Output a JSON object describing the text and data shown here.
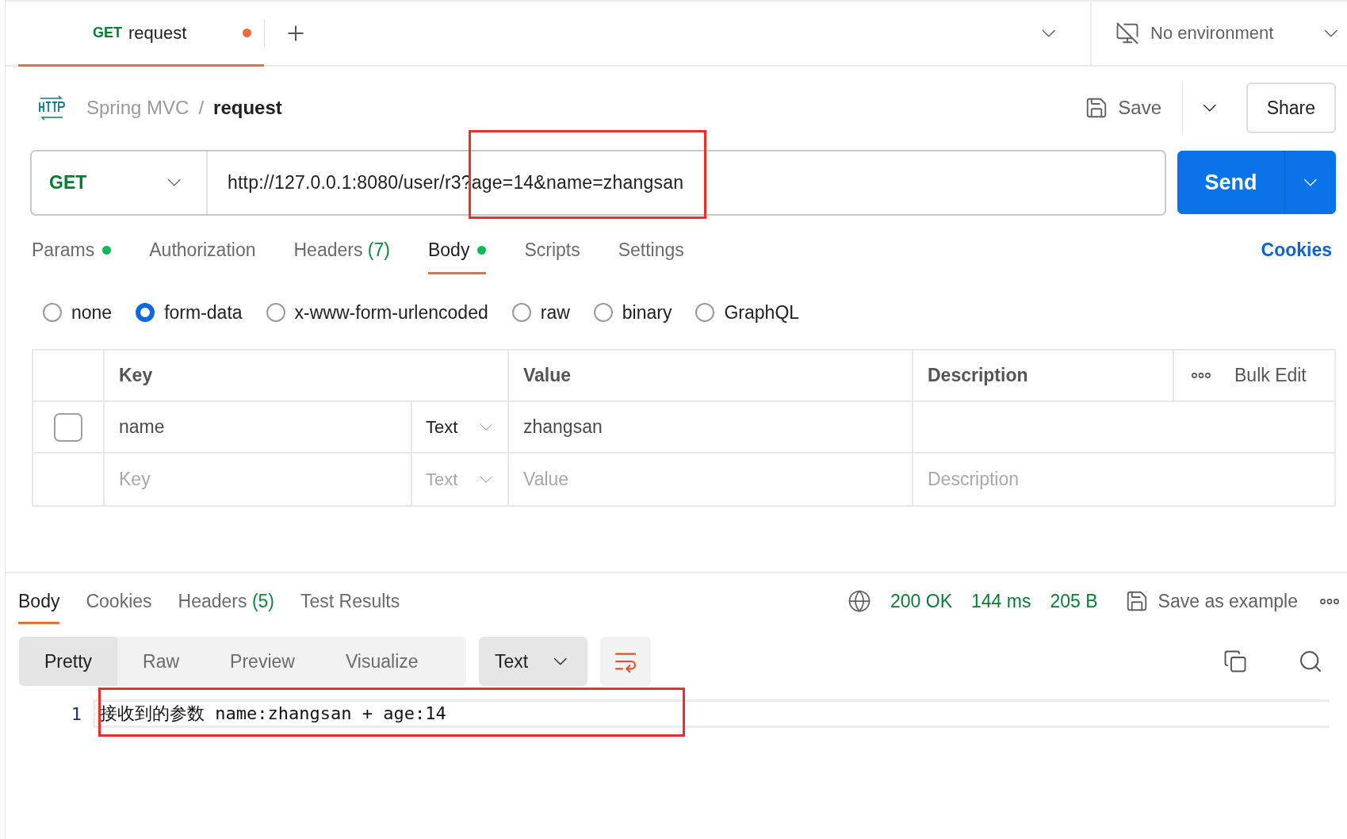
{
  "tabs": [
    {
      "method": "GET",
      "label": "request",
      "unsaved": true,
      "selected": true
    }
  ],
  "environment": {
    "label": "No environment"
  },
  "breadcrumb": {
    "collection": "Spring MVC",
    "separator": "/",
    "request": "request"
  },
  "actions": {
    "save": "Save",
    "share": "Share"
  },
  "request": {
    "method": "GET",
    "url": "http://127.0.0.1:8080/user/r3?age=14&name=zhangsan",
    "send": "Send"
  },
  "request_tabs": [
    {
      "label": "Params",
      "dot": true,
      "selected": false
    },
    {
      "label": "Authorization",
      "dot": false,
      "selected": false
    },
    {
      "label": "Headers",
      "count": "(7)",
      "dot": false,
      "selected": false
    },
    {
      "label": "Body",
      "dot": true,
      "selected": true
    },
    {
      "label": "Scripts",
      "dot": false,
      "selected": false
    },
    {
      "label": "Settings",
      "dot": false,
      "selected": false
    }
  ],
  "cookies_link": "Cookies",
  "body_types": [
    {
      "label": "none",
      "selected": false
    },
    {
      "label": "form-data",
      "selected": true
    },
    {
      "label": "x-www-form-urlencoded",
      "selected": false
    },
    {
      "label": "raw",
      "selected": false
    },
    {
      "label": "binary",
      "selected": false
    },
    {
      "label": "GraphQL",
      "selected": false
    }
  ],
  "table": {
    "columns": [
      "Key",
      "Value",
      "Description"
    ],
    "bulk_edit": "Bulk Edit",
    "rows": [
      {
        "checked": false,
        "key": "name",
        "type": "Text",
        "value": "zhangsan"
      }
    ],
    "empty_row": {
      "key_placeholder": "Key",
      "type": "Text",
      "value_placeholder": "Value",
      "description_placeholder": "Description"
    }
  },
  "response": {
    "tabs": [
      {
        "label": "Body",
        "selected": true
      },
      {
        "label": "Cookies",
        "selected": false
      },
      {
        "label": "Headers",
        "count": "(5)",
        "selected": false
      },
      {
        "label": "Test Results",
        "selected": false
      }
    ],
    "status": "200 OK",
    "time": "144 ms",
    "size": "205 B",
    "save_example": "Save as example",
    "views": [
      {
        "label": "Pretty",
        "selected": true
      },
      {
        "label": "Raw",
        "selected": false
      },
      {
        "label": "Preview",
        "selected": false
      },
      {
        "label": "Visualize",
        "selected": false
      }
    ],
    "format": "Text",
    "lines": [
      {
        "number": "1",
        "text": "接收到的参数 name:zhangsan + age:14",
        "highlighted": true
      }
    ]
  }
}
